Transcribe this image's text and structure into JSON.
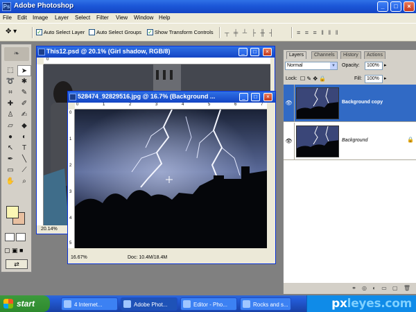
{
  "app": {
    "title": "Adobe Photoshop",
    "icon": "ps-icon",
    "window_buttons": [
      "_",
      "□",
      "×"
    ]
  },
  "menu": [
    "File",
    "Edit",
    "Image",
    "Layer",
    "Select",
    "Filter",
    "View",
    "Window",
    "Help"
  ],
  "options": {
    "tool_icon": "move-tool-icon",
    "auto_select_layer": {
      "label": "Auto Select Layer",
      "checked": true
    },
    "auto_select_groups": {
      "label": "Auto Select Groups",
      "checked": false
    },
    "show_transform_controls": {
      "label": "Show Transform Controls",
      "checked": true
    }
  },
  "documents": {
    "back": {
      "title": "This12.psd @ 20.1% (Girl shadow, RGB/8)",
      "zoom": "20.14%",
      "ruler_h": [
        "0"
      ],
      "ruler_v": []
    },
    "front": {
      "title": "528474_92829516.jpg @ 16.7% (Background ...",
      "zoom": "16.67%",
      "doc_size": "Doc: 10.4M/18.4M",
      "ruler_h": [
        "0",
        "1",
        "2",
        "3",
        "4",
        "5",
        "6",
        "7"
      ],
      "ruler_v": [
        "0",
        "1",
        "2",
        "3",
        "4",
        "5"
      ]
    }
  },
  "layers_panel": {
    "tabs": [
      "Layers",
      "Channels",
      "History",
      "Actions"
    ],
    "active_tab": "Layers",
    "blend_mode": "Normal",
    "opacity_label": "Opacity:",
    "opacity": "100%",
    "lock_label": "Lock:",
    "fill_label": "Fill:",
    "fill": "100%",
    "layers": [
      {
        "name": "Background copy",
        "selected": true,
        "visible": true,
        "locked": false
      },
      {
        "name": "Background",
        "selected": false,
        "visible": true,
        "locked": true
      }
    ]
  },
  "taskbar": {
    "start": "start",
    "items": [
      {
        "label": "4 Internet...",
        "active": false
      },
      {
        "label": "Adobe Phot...",
        "active": true
      },
      {
        "label": "Editor - Pho...",
        "active": false
      },
      {
        "label": "Rocks and s...",
        "active": false
      }
    ],
    "watermark": {
      "a": "px",
      "b": "leyes.com"
    }
  },
  "colors": {
    "xp_blue": "#1c57d8",
    "selected_layer": "#316ac5",
    "foreground_swatch": "#fbf6b4",
    "background_swatch": "#e8bfa0"
  }
}
